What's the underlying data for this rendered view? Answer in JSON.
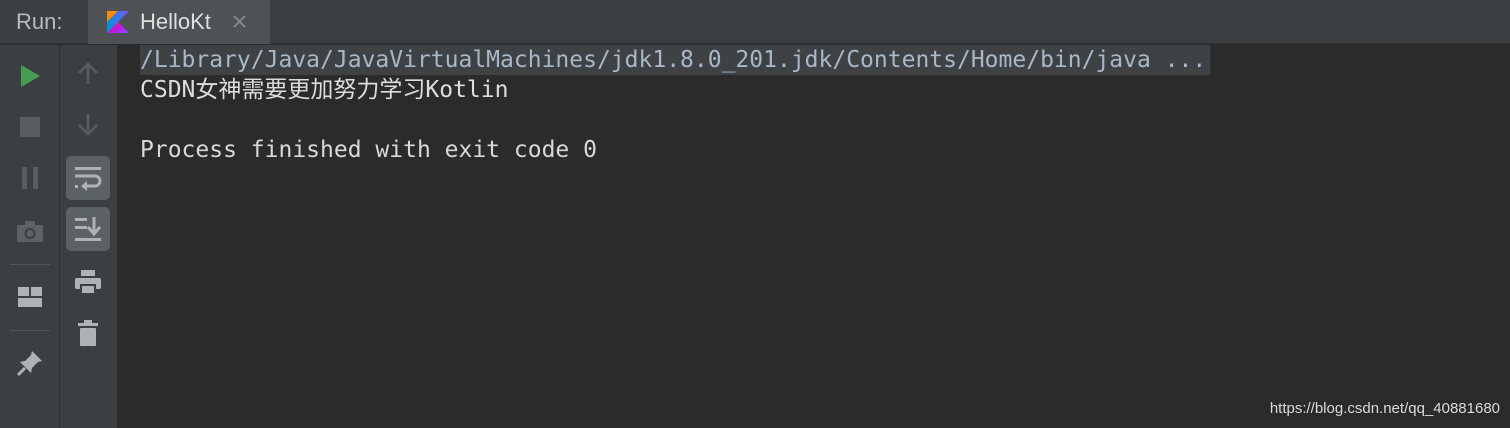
{
  "header": {
    "run_label": "Run:",
    "tab": {
      "label": "HelloKt",
      "icon": "kotlin-icon",
      "close_icon": "close-icon"
    }
  },
  "toolbar_left": {
    "items": [
      {
        "name": "run-icon",
        "color": "#499c54"
      },
      {
        "name": "stop-icon"
      },
      {
        "name": "pause-icon"
      },
      {
        "name": "camera-icon"
      },
      {
        "name": "layout-icon"
      },
      {
        "name": "pin-icon"
      }
    ]
  },
  "toolbar_right": {
    "items": [
      {
        "name": "arrow-up-icon"
      },
      {
        "name": "arrow-down-icon"
      },
      {
        "name": "soft-wrap-icon",
        "active": true
      },
      {
        "name": "scroll-to-end-icon",
        "active": true
      },
      {
        "name": "print-icon"
      },
      {
        "name": "trash-icon"
      }
    ]
  },
  "console": {
    "lines": [
      "/Library/Java/JavaVirtualMachines/jdk1.8.0_201.jdk/Contents/Home/bin/java ...",
      "CSDN女神需要更加努力学习Kotlin",
      "",
      "Process finished with exit code 0"
    ]
  },
  "watermark": "https://blog.csdn.net/qq_40881680",
  "colors": {
    "background": "#2b2b2b",
    "toolbar": "#3c3f41",
    "run_green": "#499c54",
    "icon_gray": "#afb1b3"
  }
}
